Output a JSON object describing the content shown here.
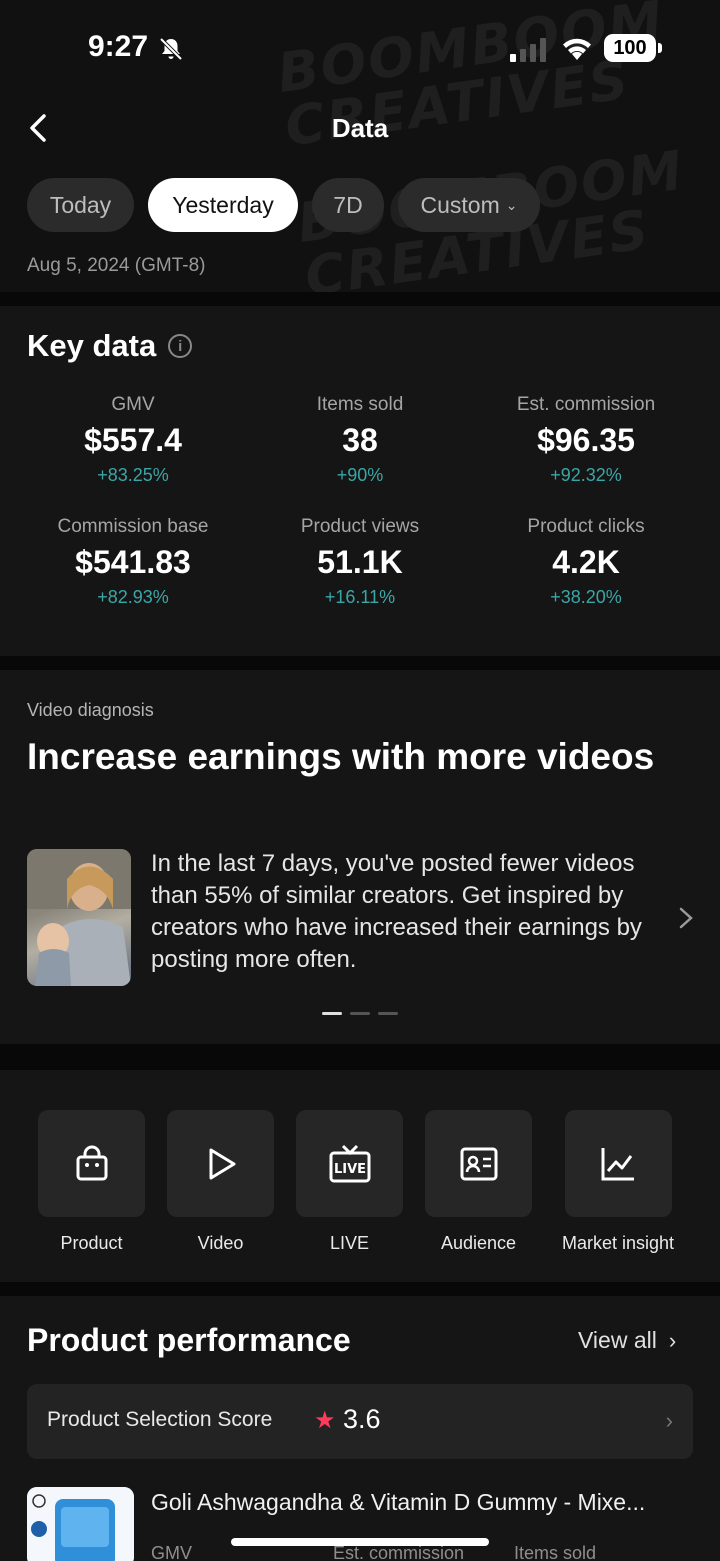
{
  "status_bar": {
    "time": "9:27",
    "battery": "100"
  },
  "header": {
    "title": "Data"
  },
  "tabs": [
    {
      "label": "Today"
    },
    {
      "label": "Yesterday"
    },
    {
      "label": "7D"
    },
    {
      "label": "Custom"
    }
  ],
  "date_range": "Aug 5, 2024 (GMT-8)",
  "key_data": {
    "title": "Key data",
    "metrics": [
      {
        "label": "GMV",
        "value": "$557.4",
        "change": "+83.25%"
      },
      {
        "label": "Items sold",
        "value": "38",
        "change": "+90%"
      },
      {
        "label": "Est. commission",
        "value": "$96.35",
        "change": "+92.32%"
      },
      {
        "label": "Commission base",
        "value": "$541.83",
        "change": "+82.93%"
      },
      {
        "label": "Product views",
        "value": "51.1K",
        "change": "+16.11%"
      },
      {
        "label": "Product clicks",
        "value": "4.2K",
        "change": "+38.20%"
      }
    ]
  },
  "video_diagnosis": {
    "label": "Video diagnosis",
    "title": "Increase earnings with more videos",
    "body": "In the last 7 days, you've posted fewer videos than 55% of similar creators. Get inspired by creators who have increased their earnings by posting more often."
  },
  "shortcuts": [
    {
      "label": "Product",
      "icon": "shopping-bag-icon"
    },
    {
      "label": "Video",
      "icon": "play-icon"
    },
    {
      "label": "LIVE",
      "icon": "live-tv-icon"
    },
    {
      "label": "Audience",
      "icon": "id-card-icon"
    },
    {
      "label": "Market insight",
      "icon": "line-chart-icon"
    }
  ],
  "product_performance": {
    "title": "Product performance",
    "view_all": "View all",
    "score_label": "Product Selection Score",
    "score_value": "3.6",
    "product_name": "Goli Ashwagandha & Vitamin D Gummy - Mixe...",
    "columns": [
      "GMV",
      "Est. commission",
      "Items sold"
    ]
  },
  "watermark": {
    "line1": "BOOMBOOM",
    "line2": "CREATIVES"
  }
}
